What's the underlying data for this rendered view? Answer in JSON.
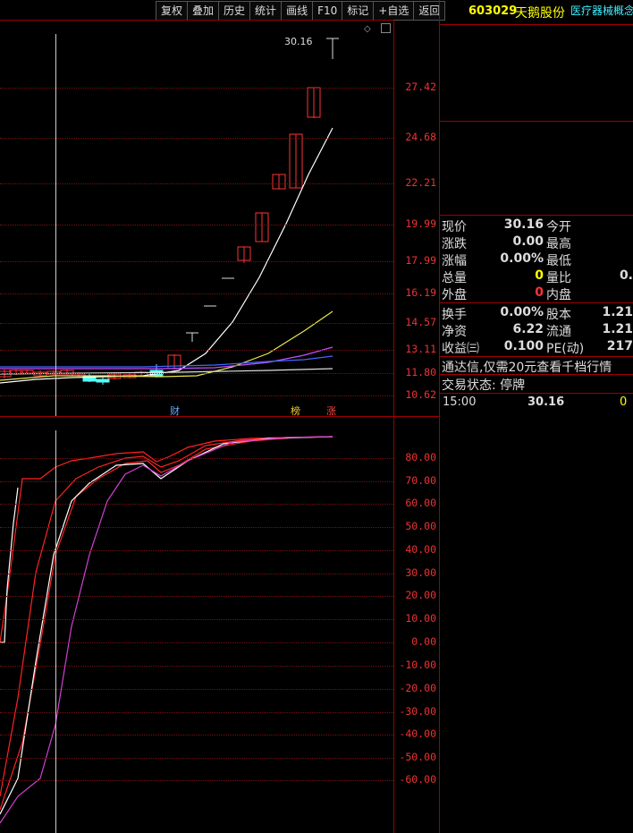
{
  "toolbar": {
    "buttons": [
      "复权",
      "叠加",
      "历史",
      "统计",
      "画线",
      "F10",
      "标记",
      "+自选",
      "返回"
    ]
  },
  "header": {
    "code": "603029",
    "name": "天鹅股份",
    "concept": "医疗器械概念"
  },
  "price_axis": [
    "27.42",
    "24.68",
    "22.21",
    "19.99",
    "17.99",
    "16.19",
    "14.57",
    "13.11",
    "11.80",
    "10.62"
  ],
  "indicator_axis": [
    "80.00",
    "70.00",
    "60.00",
    "50.00",
    "40.00",
    "30.00",
    "20.00",
    "10.00",
    "0.00",
    "-10.00",
    "-20.00",
    "-30.00",
    "-40.00",
    "-50.00",
    "-60.00"
  ],
  "high_marker": "30.16",
  "event_markers": {
    "cai": "财",
    "bang": "榜",
    "zhang": "涨"
  },
  "quote": {
    "rows1": [
      {
        "l1": "现价",
        "v1": "30.16",
        "l2": "今开",
        "v2": ""
      },
      {
        "l1": "涨跌",
        "v1": "0.00",
        "l2": "最高",
        "v2": ""
      },
      {
        "l1": "涨幅",
        "v1": "0.00%",
        "l2": "最低",
        "v2": ""
      },
      {
        "l1": "总量",
        "v1": "0",
        "l2": "量比",
        "v2": "0."
      },
      {
        "l1": "外盘",
        "v1": "0",
        "l2": "内盘",
        "v2": ""
      }
    ],
    "rows2": [
      {
        "l1": "换手",
        "v1": "0.00%",
        "l2": "股本",
        "v2": "1.21"
      },
      {
        "l1": "净资",
        "v1": "6.22",
        "l2": "流通",
        "v2": "1.21"
      },
      {
        "l1": "收益㈢",
        "v1": "0.100",
        "l2": "PE(动)",
        "v2": "217"
      }
    ],
    "notice": "通达信,仅需20元查看千档行情",
    "trade_status": "交易状态: 停牌",
    "tick": {
      "time": "15:00",
      "price": "30.16",
      "vol": "0"
    }
  },
  "colors": {
    "up": "#ff3232",
    "down": "#54ffff",
    "axis": "#a00000",
    "grid": "#7a1010"
  }
}
